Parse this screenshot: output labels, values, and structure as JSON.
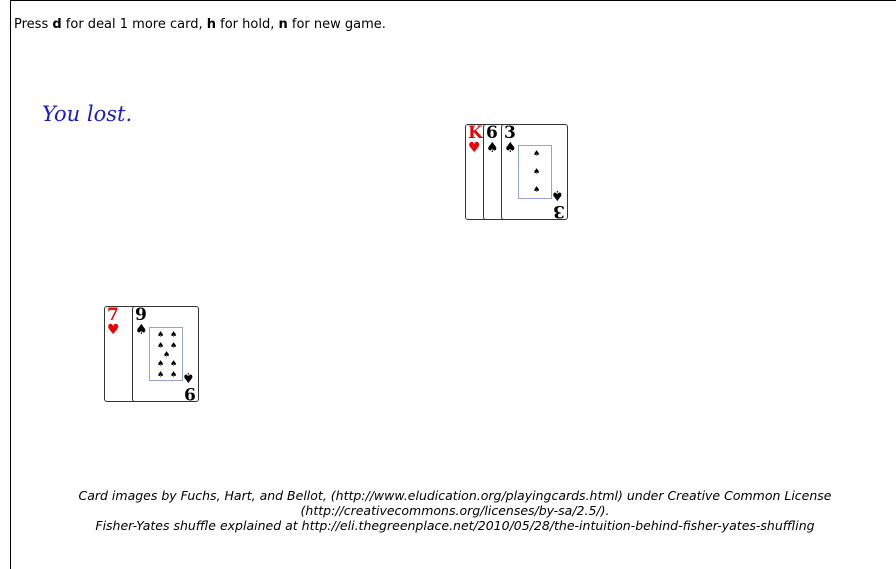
{
  "instructions": {
    "t1": "Press ",
    "k1": "d",
    "t2": " for deal 1 more card, ",
    "k2": "h",
    "t3": " for hold, ",
    "k3": "n",
    "t4": " for new game."
  },
  "status": "You lost.",
  "dealer_hand": [
    {
      "rank": "K",
      "suit": "♥",
      "color": "#e00000"
    },
    {
      "rank": "6",
      "suit": "♠",
      "color": "#000000"
    },
    {
      "rank": "3",
      "suit": "♠",
      "color": "#000000"
    }
  ],
  "player_hand": [
    {
      "rank": "7",
      "suit": "♥",
      "color": "#e00000"
    },
    {
      "rank": "9",
      "suit": "♠",
      "color": "#000000"
    }
  ],
  "credits": {
    "line1": "Card images by Fuchs, Hart, and Bellot, (http://www.eludication.org/playingcards.html) under Creative Common License",
    "line2": "(http://creativecommons.org/licenses/by-sa/2.5/).",
    "line3": "Fisher-Yates shuffle explained at http://eli.thegreenplace.net/2010/05/28/the-intuition-behind-fisher-yates-shuffling"
  }
}
